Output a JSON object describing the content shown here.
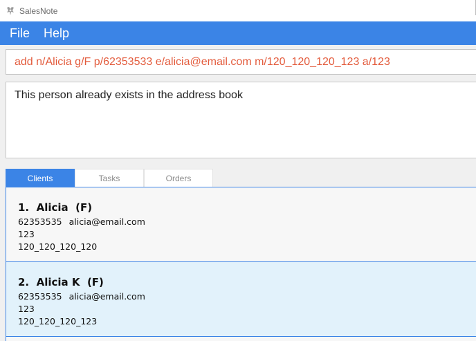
{
  "window": {
    "title": "SalesNote"
  },
  "menu": {
    "items": [
      "File",
      "Help"
    ]
  },
  "command": {
    "text": "add n/Alicia g/F p/62353533 e/alicia@email.com m/120_120_120_123 a/123"
  },
  "result": {
    "text": "This person already exists in the address book"
  },
  "tabs": [
    {
      "label": "Clients",
      "active": true
    },
    {
      "label": "Tasks",
      "active": false
    },
    {
      "label": "Orders",
      "active": false
    }
  ],
  "clients": [
    {
      "index": "1.",
      "name": "Alicia",
      "gender": "(F)",
      "phone": "62353535",
      "email": "alicia@email.com",
      "address": "123",
      "measurement": "120_120_120_120"
    },
    {
      "index": "2.",
      "name": "Alicia K",
      "gender": "(F)",
      "phone": "62353535",
      "email": "alicia@email.com",
      "address": "123",
      "measurement": "120_120_120_123"
    }
  ],
  "colors": {
    "accent": "#3b84e6",
    "command_text": "#e35b3c",
    "selected_card": "#e2f2fb"
  }
}
